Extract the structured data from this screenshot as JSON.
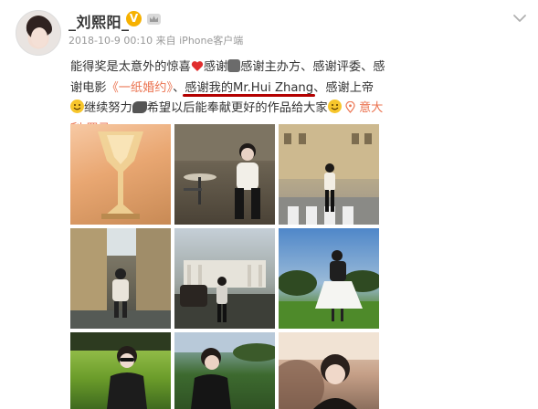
{
  "header": {
    "username": "_刘熙阳_",
    "verified_badge": "V",
    "crown_icon": "crown-icon",
    "more_icon": "chevron-down-icon",
    "timestamp": "2018-10-9 00:10",
    "source_prefix": "来自",
    "source": "iPhone客户端"
  },
  "post": {
    "seg1": "能得奖是太意外的惊喜",
    "seg2": "感谢",
    "seg3": "感谢主办方、感谢评委、感谢电影",
    "film_link": "《一纸婚约》",
    "seg4": "、",
    "thanks_my": "感谢我的",
    "name_highlight": "Mr.Hui Zhang",
    "seg5": "、感谢上帝",
    "seg6": "继续努力",
    "seg7": "希望以后能奉献更好的作品给大家",
    "location_icon": "location-pin-icon",
    "location": "意大利·罗马",
    "emoji_heart": "heart-emoji",
    "emoji_clap": "clap-emoji",
    "emoji_smile": "smile-emoji",
    "emoji_muscle": "muscle-emoji"
  },
  "photos": [
    {
      "name": "trophy-photo"
    },
    {
      "name": "cafe-photo"
    },
    {
      "name": "street-crosswalk-photo"
    },
    {
      "name": "alley-photo"
    },
    {
      "name": "monument-photo"
    },
    {
      "name": "park-white-dress-photo"
    },
    {
      "name": "grass-sunglasses-photo"
    },
    {
      "name": "grass-leather-jacket-photo"
    },
    {
      "name": "closeup-portrait-photo"
    }
  ],
  "colors": {
    "link": "#eb7350",
    "underline": "#b30000",
    "badge": "#f6b100"
  }
}
